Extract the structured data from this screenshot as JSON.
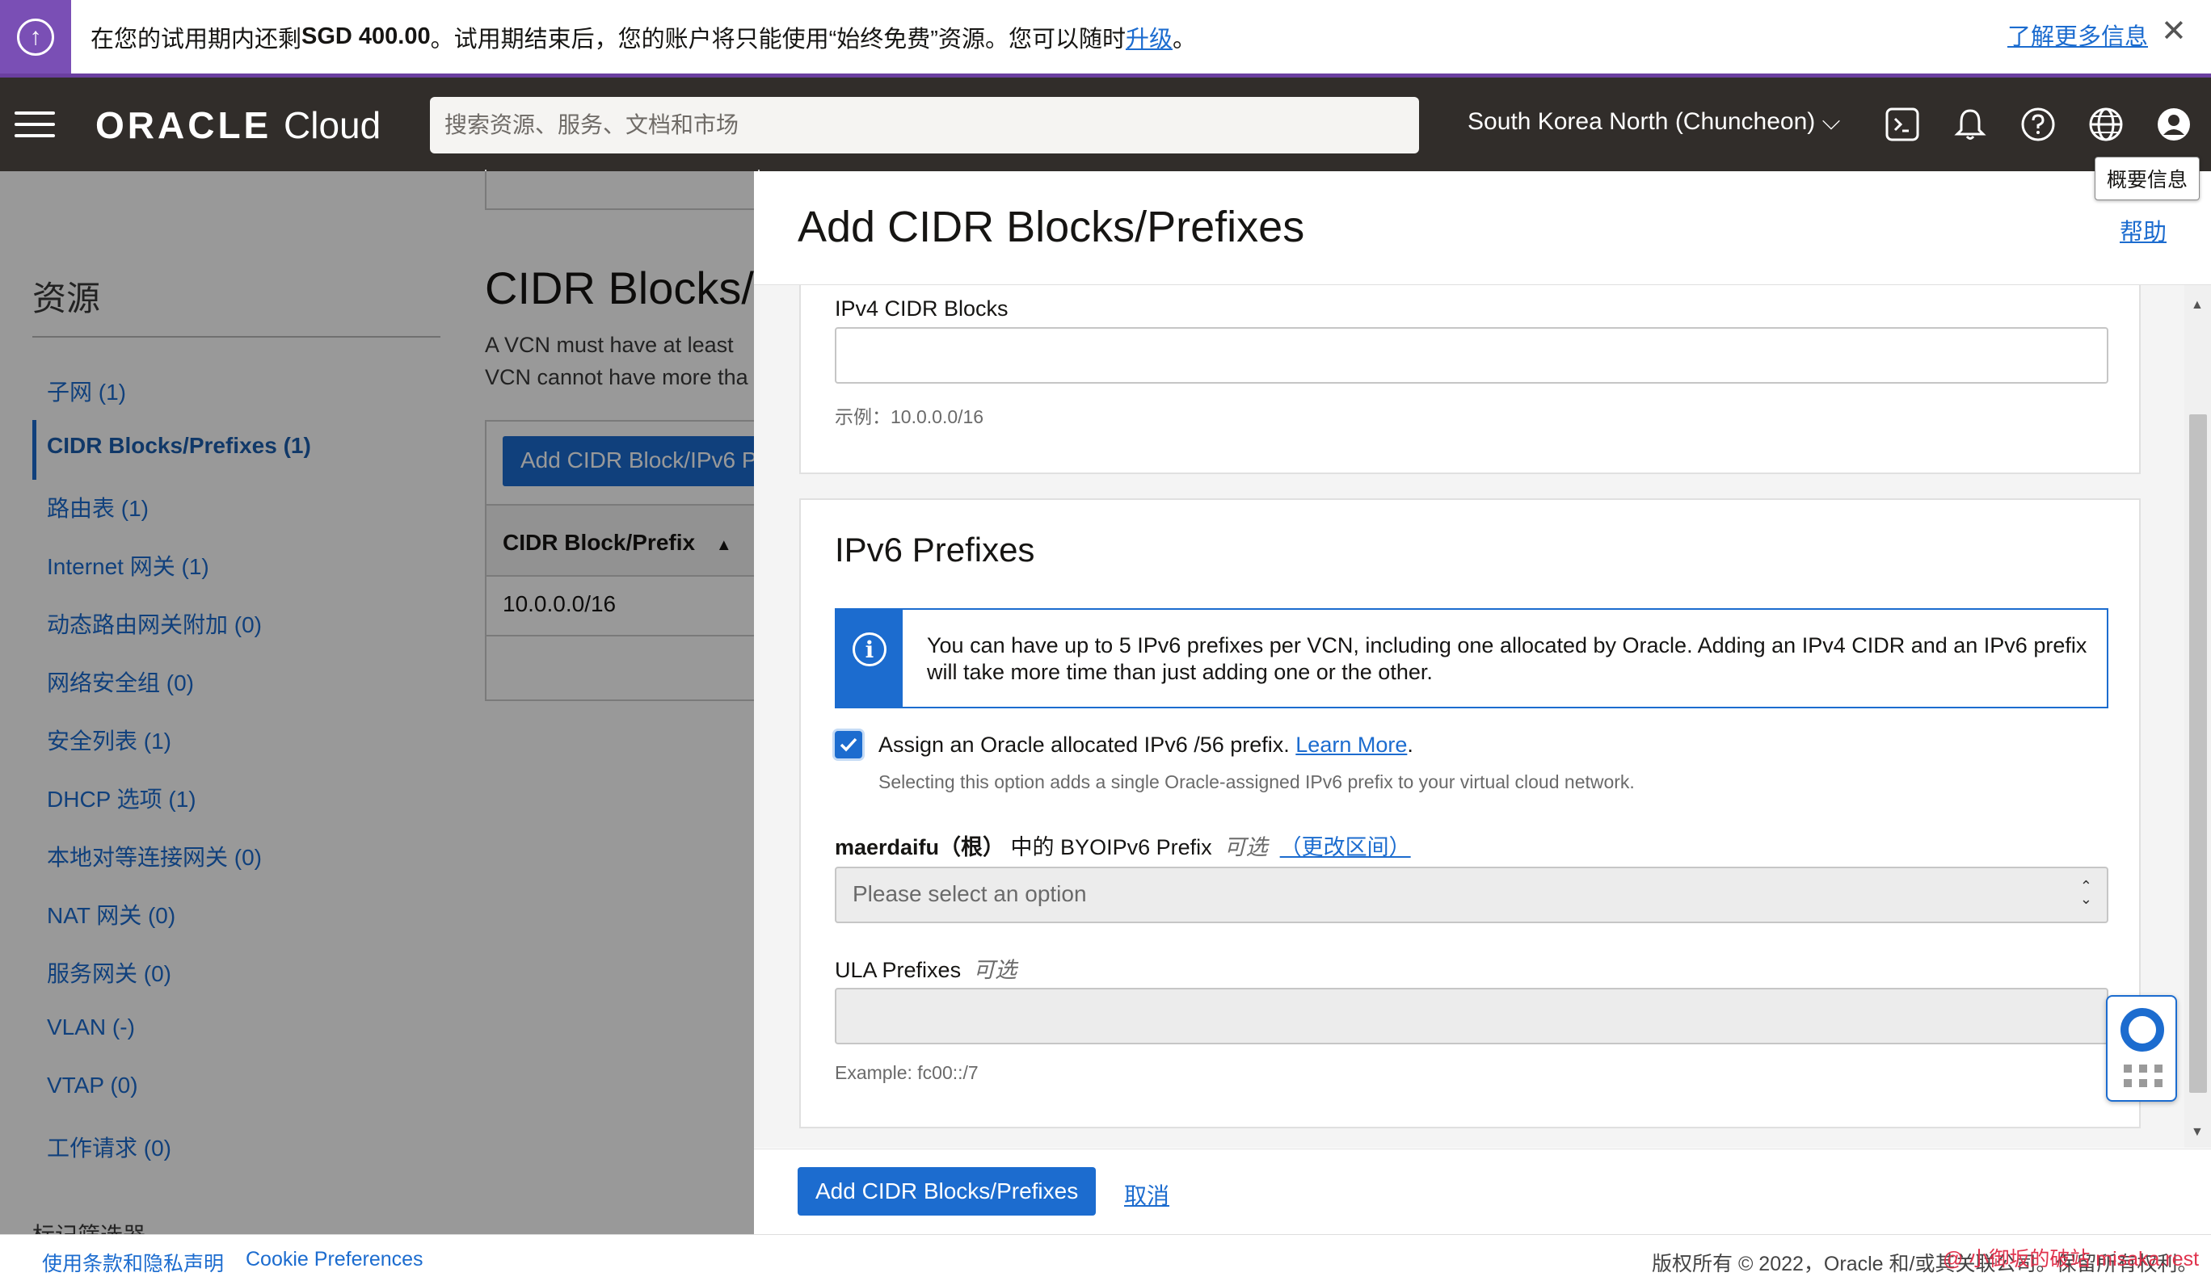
{
  "banner": {
    "msg_prefix": "在您的试用期内还剩 ",
    "amount": "SGD 400.00",
    "msg_middle": "。试用期结束后，您的账户将只能使用“始终免费”资源。您可以随时",
    "upgrade_link": "升级",
    "msg_suffix": "。",
    "learn_more": "了解更多信息",
    "close_label": "✕",
    "icon": "arrow-up-circle-icon",
    "accent_color": "#7a4fb5"
  },
  "header": {
    "logo_brand": "ORACLE",
    "logo_product": "Cloud",
    "search_placeholder": "搜索资源、服务、文档和市场",
    "region": "South Korea North (Chuncheon)",
    "icons": [
      "cloud-shell-icon",
      "bell-icon",
      "help-icon",
      "globe-icon",
      "profile-icon"
    ],
    "background": "#312d2a"
  },
  "tooltip": {
    "text": "概要信息"
  },
  "background_page": {
    "resources_title": "资源",
    "resources": [
      {
        "label": "子网 (1)",
        "active": false
      },
      {
        "label": "CIDR Blocks/Prefixes (1)",
        "active": true
      },
      {
        "label": "路由表 (1)",
        "active": false
      },
      {
        "label": "Internet 网关 (1)",
        "active": false
      },
      {
        "label": "动态路由网关附加 (0)",
        "active": false
      },
      {
        "label": "网络安全组 (0)",
        "active": false
      },
      {
        "label": "安全列表 (1)",
        "active": false
      },
      {
        "label": "DHCP 选项 (1)",
        "active": false
      },
      {
        "label": "本地对等连接网关 (0)",
        "active": false
      },
      {
        "label": "NAT 网关 (0)",
        "active": false
      },
      {
        "label": "服务网关 (0)",
        "active": false
      },
      {
        "label": "VLAN (-)",
        "active": false
      },
      {
        "label": "VTAP (0)",
        "active": false
      },
      {
        "label": "工作请求 (0)",
        "active": false
      }
    ],
    "partial_label": "标记筛选器",
    "main_title": "CIDR Blocks/",
    "desc_line1": "A VCN must have at least",
    "desc_line2": "VCN cannot have more tha",
    "add_button": "Add CIDR Block/IPv6 P",
    "table_header": "CIDR Block/Prefix",
    "table_row": "10.0.0.0/16"
  },
  "panel": {
    "title": "Add CIDR Blocks/Prefixes",
    "help": "帮助",
    "ipv4": {
      "label": "IPv4 CIDR Blocks",
      "value": "",
      "hint": "示例：10.0.0.0/16"
    },
    "ipv6": {
      "title": "IPv6 Prefixes",
      "info_text": "You can have up to 5 IPv6 prefixes per VCN, including one allocated by Oracle. Adding an IPv4 CIDR and an IPv6 prefix will take more time than just adding one or the other.",
      "checkbox_label": "Assign an Oracle allocated IPv6 /56 prefix. ",
      "checkbox_link": "Learn More",
      "checkbox_after": ".",
      "checked": true,
      "checkbox_hint": "Selecting this option adds a single Oracle-assigned IPv6 prefix to your virtual cloud network.",
      "byoip_compartment": "maerdaifu（根）",
      "byoip_label": " 中的 BYOIPv6 Prefix",
      "optional": "可选",
      "change_compartment": "（更改区间）",
      "select_placeholder": "Please select an option",
      "ula_label": "ULA Prefixes",
      "ula_hint": "Example: fc00::/7"
    },
    "submit": "Add CIDR Blocks/Prefixes",
    "cancel": "取消",
    "primary_color": "#1c6ccf"
  },
  "page_footer": {
    "terms": "使用条款和隐私声明",
    "cookies": "Cookie Preferences",
    "copyright": "版权所有 © 2022，Oracle 和/或其关联公司。保留所有权利。",
    "watermark": "@ 小御坂的破站 misaka.rest"
  }
}
